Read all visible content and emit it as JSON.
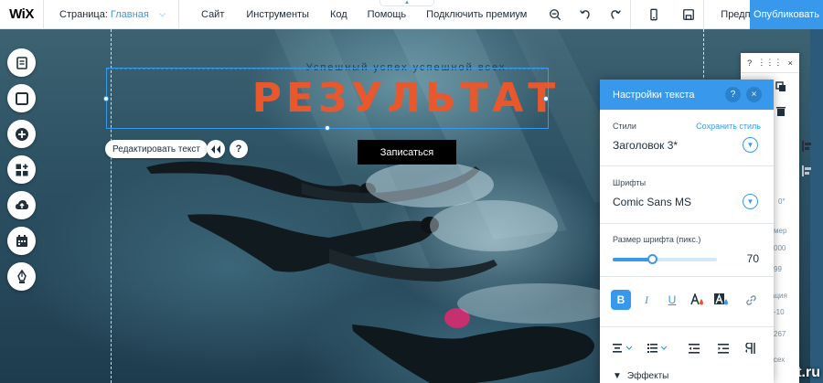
{
  "topbar": {
    "logo": "WiX",
    "page_label": "Страница:",
    "page_name": "Главная",
    "menu": [
      "Сайт",
      "Инструменты",
      "Код",
      "Помощь",
      "Подключить премиум"
    ],
    "preview": "Предпросмотр",
    "publish": "Опубликовать"
  },
  "hero": {
    "subtitle": "Успешный успех успешной всех",
    "headline": "РЕЗУЛЬТАТ",
    "cta": "Записаться",
    "edit_text": "Редактировать текст",
    "help_glyph": "?"
  },
  "left_tools": [
    "menu-pages-icon",
    "background-icon",
    "add-icon",
    "apps-icon",
    "upload-icon",
    "bookings-icon",
    "blog-pen-icon"
  ],
  "panel": {
    "title": "Настройки текста",
    "help": "?",
    "close": "×",
    "styles_label": "Стили",
    "save_style": "Сохранить стиль",
    "style_value": "Заголовок 3*",
    "fonts_label": "Шрифты",
    "font_value": "Comic Sans MS",
    "size_label": "Размер шрифта (пикс.)",
    "size_value": "70",
    "size_fraction": 0.38,
    "format_buttons": {
      "bold": "B",
      "italic": "I",
      "underline": "U"
    },
    "effects": "Эффекты"
  },
  "side_panel": {
    "help": "?",
    "grip": "⋮⋮⋮",
    "close": "×",
    "fragments": [
      "0°",
      "мер",
      "000",
      "99",
      "ация",
      "-10",
      "267",
      "сех"
    ]
  },
  "watermark": "uptut.ru",
  "colors": {
    "accent": "#3899ec",
    "headline": "#e9582c"
  }
}
